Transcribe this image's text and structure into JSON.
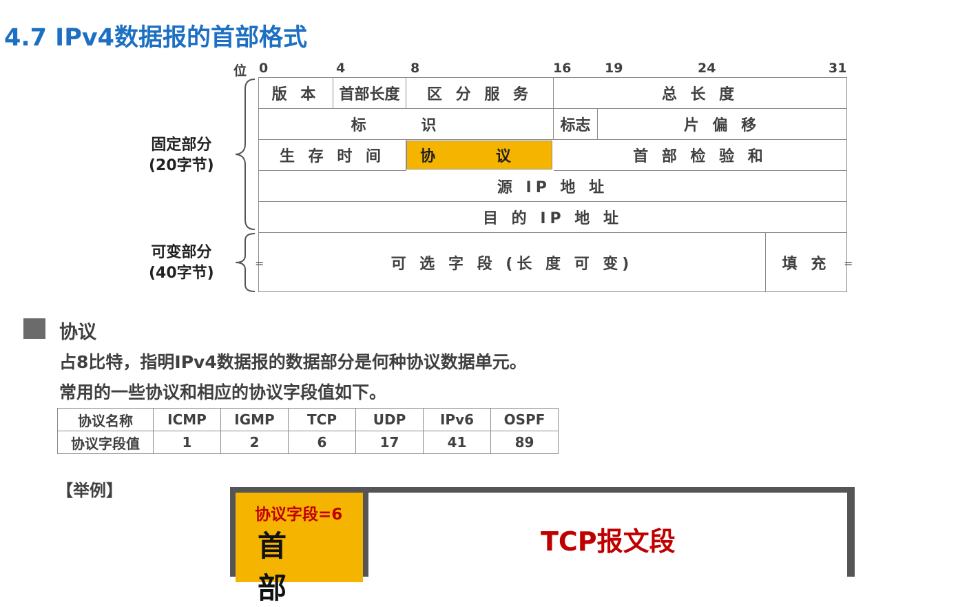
{
  "title": "4.7 IPv4数据报的首部格式",
  "bit_label": "位",
  "bit_positions": [
    "0",
    "4",
    "8",
    "16",
    "19",
    "24",
    "31"
  ],
  "header_fields": {
    "version": "版 本",
    "ihl": "首部长度",
    "dscp": "区 分 服 务",
    "total_length": "总 长 度",
    "identification": "标 识",
    "flags": "标志",
    "fragment_offset": "片 偏 移",
    "ttl": "生 存 时 间",
    "protocol": "协 议",
    "checksum": "首 部 检 验 和",
    "src_ip": "源 IP 地 址",
    "dst_ip": "目 的 IP 地 址",
    "options": "可 选 字 段 (长 度 可 变)",
    "padding": "填 充"
  },
  "side_labels": {
    "fixed_line1": "固定部分",
    "fixed_line2": "(20字节)",
    "variable_line1": "可变部分",
    "variable_line2": "(40字节)"
  },
  "eq_mark": "=",
  "highlight_color": "#f5b400",
  "title_color": "#1c6fc2",
  "section": {
    "heading": "协议",
    "line1": "占8比特，指明IPv4数据报的数据部分是何种协议数据单元。",
    "line2": "常用的一些协议和相应的协议字段值如下。"
  },
  "protocol_table": {
    "row_labels": [
      "协议名称",
      "协议字段值"
    ],
    "names": [
      "ICMP",
      "IGMP",
      "TCP",
      "UDP",
      "IPv6",
      "OSPF"
    ],
    "values": [
      "1",
      "2",
      "6",
      "17",
      "41",
      "89"
    ]
  },
  "example": {
    "label": "【举例】",
    "field_note": "协议字段=6",
    "header_text": "首 部",
    "payload_text": "TCP报文段"
  }
}
